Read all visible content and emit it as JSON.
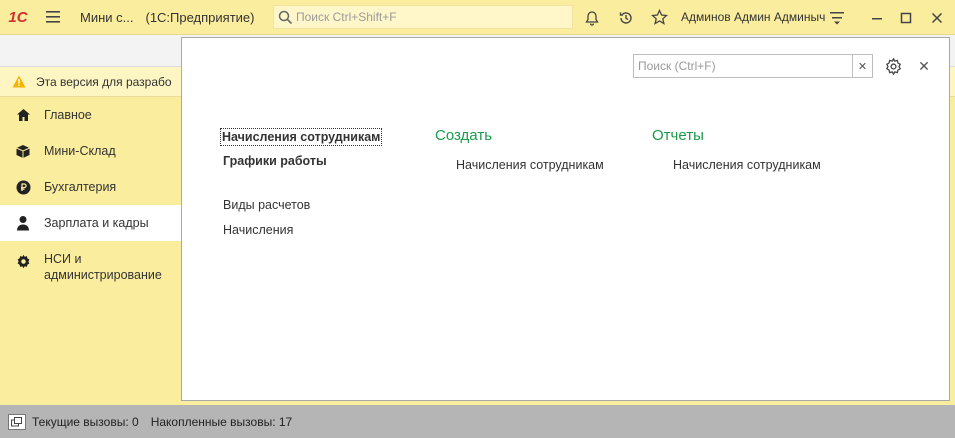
{
  "titlebar": {
    "logo": "1С",
    "app_title": "Мини с...",
    "app_subtitle": "(1С:Предприятие)",
    "search_placeholder": "Поиск Ctrl+Shift+F",
    "user_name": "Админов Админ Админыч"
  },
  "warning": {
    "text": "Эта версия для разрабо"
  },
  "sidebar": {
    "items": [
      {
        "label": "Главное",
        "icon": "home-icon"
      },
      {
        "label": "Мини-Склад",
        "icon": "box-icon"
      },
      {
        "label": "Бухгалтерия",
        "icon": "ruble-icon"
      },
      {
        "label": "Зарплата и кадры",
        "icon": "person-icon",
        "active": true
      },
      {
        "label": "НСИ и администрирование",
        "icon": "gear-icon"
      }
    ]
  },
  "panel": {
    "search_placeholder": "Поиск (Ctrl+F)",
    "search_value": "",
    "nav": {
      "bold_items": [
        "Начисления сотрудникам",
        "Графики работы"
      ],
      "links": [
        "Виды расчетов",
        "Начисления"
      ]
    },
    "create": {
      "title": "Создать",
      "items": [
        "Начисления сотрудникам"
      ]
    },
    "reports": {
      "title": "Отчеты",
      "items": [
        "Начисления сотрудникам"
      ]
    }
  },
  "statusbar": {
    "current_calls": "Текущие вызовы: 0",
    "accumulated_calls": "Накопленные вызовы: 17"
  },
  "colors": {
    "accent_yellow": "#fbed9e",
    "section_green": "#1a9a4a",
    "logo_red": "#d32f2f"
  }
}
